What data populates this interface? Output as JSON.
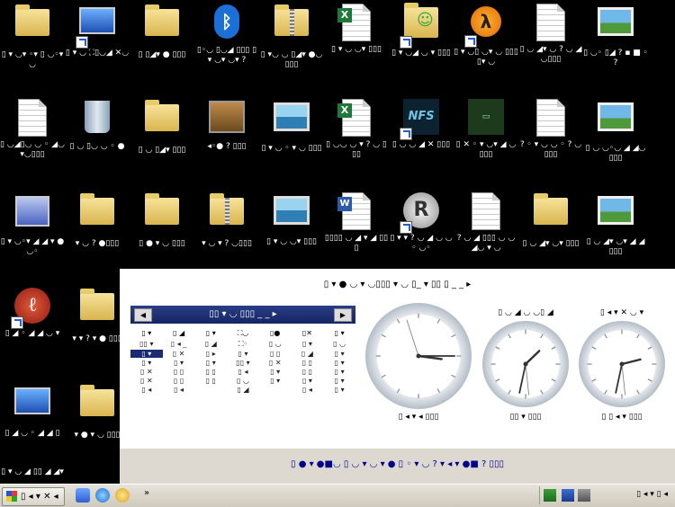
{
  "desktop": {
    "icons": [
      {
        "label": "▯ ▾ ◡▾ ◦▾ ▯ ◡◦▾ ◡",
        "kind": "folder-glass"
      },
      {
        "label": "▯ ▾ ◡ ⛶▯◡◢ ✕◡",
        "kind": "computer-net"
      },
      {
        "label": "▯ ▯◢▾ ● ▯▯▯",
        "kind": "folder"
      },
      {
        "label": "▯◦◡ ▯◡◢ ▯▯▯ ▯ ▾ ◡▾ ◡▾ ?",
        "kind": "bluetooth"
      },
      {
        "label": "▯ ▾◡ ◡ ▯◢▾ ●◡▯▯▯",
        "kind": "zip"
      },
      {
        "label": "▯ ▾ ◡ ◡▾ ▯▯▯",
        "kind": "excel"
      },
      {
        "label": "▯ ▾ ◡◢ ◡ ▾ ▯▯▯",
        "kind": "user-folder"
      },
      {
        "label": "▯ ▾ ◡▯ ◡▾ ◡ ▯▯▯ ▯▾ ◡",
        "kind": "halflife2"
      },
      {
        "label": "▯ ◡ ◢▾ ◡ ? ◡ ◢◡▯▯▯",
        "kind": "text"
      },
      {
        "label": "▯ ◡◦ ▯◢ ? ▪ ■ ◦ ?",
        "kind": "picture"
      },
      {
        "label": "▯ ◡◢▯◡ ◡ ◦ ◢◡ ▾◡▯▯▯",
        "kind": "text"
      },
      {
        "label": "▯ ◡ ▯◡ ◡ ◦ ●",
        "kind": "recycle"
      },
      {
        "label": "▯ ◡ ▯◢▾ ▯▯▯",
        "kind": "folder"
      },
      {
        "label": "◂◦● ? ▯▯▯",
        "kind": "network-lock"
      },
      {
        "label": "▯ ▾ ◡ ◦ ▾ ◡ ▯▯▯",
        "kind": "picture2"
      },
      {
        "label": "▯ ◡◡ ◡ ▾ ? ◡ ▯▯▯",
        "kind": "excel"
      },
      {
        "label": "▯ ◡ ◡ ◢ ✕ ▯▯▯",
        "kind": "nfs"
      },
      {
        "label": "▯ ✕ ◦ ▾ ◡▾ ◢ ◡ ▯▯▯",
        "kind": "nfs2"
      },
      {
        "label": "? ◦ ▾ ◡ ◡ ◦ ? ◡▯▯▯",
        "kind": "text"
      },
      {
        "label": "▯ ◡ ◡◦◡ ◢ ◢◡ ▯▯▯",
        "kind": "picture"
      },
      {
        "label": "▯ ▾ ◡◦▾ ◢ ◢ ▾ ● ◡◦",
        "kind": "wizard"
      },
      {
        "label": "▾ ◡ ? ●▯▯▯",
        "kind": "folder"
      },
      {
        "label": "▯ ● ▾ ◡ ▯▯▯",
        "kind": "folder"
      },
      {
        "label": "▾ ◡ ▾ ? ◡▯▯▯",
        "kind": "zip"
      },
      {
        "label": "▯ ▾ ◡ ◡▾ ▯▯▯",
        "kind": "picture2"
      },
      {
        "label": "▯▯▯▯ ◡ ◢ ▾ ◢ ▯▯▯",
        "kind": "word"
      },
      {
        "label": "▯ ▾ ▾ ? ◡ ◢ ◡ ◡ ◦ ◡◦",
        "kind": "rlogo"
      },
      {
        "label": "? ◡ ◢ ▯▯▯ ◡ ◡ ◢◡ ▾ ◡",
        "kind": "text"
      },
      {
        "label": "▯ ◡ ◢▾ ◡▾ ▯▯▯",
        "kind": "folder"
      },
      {
        "label": "▯ ◡ ◢▾ ◡▾ ◢ ◢ ▯▯▯",
        "kind": "picture"
      },
      {
        "label": "▯ ◢ ◦ ◢ ◢ ◡ ▾",
        "kind": "red"
      },
      {
        "label": "▾ ▾ ? ▾ ● ▯▯▯",
        "kind": "folder"
      },
      {
        "label": "▯ ◢ ◡ ◦ ◢ ◢ ▯",
        "kind": "computer"
      },
      {
        "label": "▾ ● ▾ ◡ ▯▯▯",
        "kind": "folder"
      },
      {
        "label": "▯ ▾ ◡ ◢ ▯▯ ◢ ◢▾",
        "kind": "none"
      }
    ]
  },
  "gadgets": {
    "title": "▯ ▾ ● ◡ ▾ ◡▯▯▯ ▾ ◡ ▯_ ▾ ▯▯ ▯ _ _ ▸",
    "calendar": {
      "month": "▯▯ ▾ ◡ ▯▯▯ _ _ ▸",
      "prev": "◀",
      "next": "▶",
      "day_headers": [
        "▯ ▾",
        "▯ ◢",
        "▯ ▾",
        "⛶◡",
        "▯●",
        "▯✕",
        "▯ ▾"
      ],
      "cells": [
        "▯▯ ▾",
        "▯ ◂ _",
        "▯ ◢",
        "⛶◦",
        "▯ ◡",
        "▯ ▾",
        "▯ ◡",
        "▯ ▾",
        "▯ ✕",
        "▯ ▸",
        "▯ ▾",
        "▯ ▯",
        "▯ ◢",
        "▯ ▾",
        "▯ ▾",
        "▯ ▾",
        "▯ ▾",
        "▯▯ ▾",
        "▯ ✕",
        "▯ ▯",
        "▯ ▾",
        "▯ ✕",
        "▯ ▯",
        "▯ ▯",
        "▯ ◂",
        "▯ ▾",
        "▯ ▯",
        "▯ ▾",
        "▯ ✕",
        "▯ ▯",
        "▯ ▯",
        "▯ ◡",
        "▯ ▾",
        "▯ ▾",
        "▯ ▾",
        "▯ ◂",
        "▯ ◂",
        "",
        "▯ ◢",
        "",
        "▯ ◂",
        "▯ ▾"
      ],
      "today_index": 7
    },
    "clocks": [
      {
        "caption": "▯ ◂ ▾ ◂ ▯▯▯",
        "name": "▯ ◡ ◢ ◡ ▯ ◢ ◡▯"
      },
      {
        "caption": "▯▯ ▾ ▯▯▯",
        "name": "▯ ◡ ◢ ◡ ◡▯ ◢"
      },
      {
        "caption": "▯ ▯ ◂ ▾ ▯▯▯",
        "name": "▯ ◂ ▾ ✕ ◡ ▾"
      }
    ],
    "footer": "▯ ● ▾ ●■◡ ▯ ◡ ▾ ◡ ▾ ● ▯ ◦ ▾ ◡ ? ▾ ◂ ▾ ●■ ? ▯▯▯"
  },
  "taskbar": {
    "start_label": "▯ ◂ ▾ ✕ ◂",
    "chevron": "»",
    "clock": "▯ ◂ ▾ ▯ ◂"
  },
  "colors": {
    "desktop": "#000000",
    "calendar_header": "#1b2c73",
    "panel_bg": "#ddd9d0",
    "taskbar": "#dcd7cc"
  }
}
